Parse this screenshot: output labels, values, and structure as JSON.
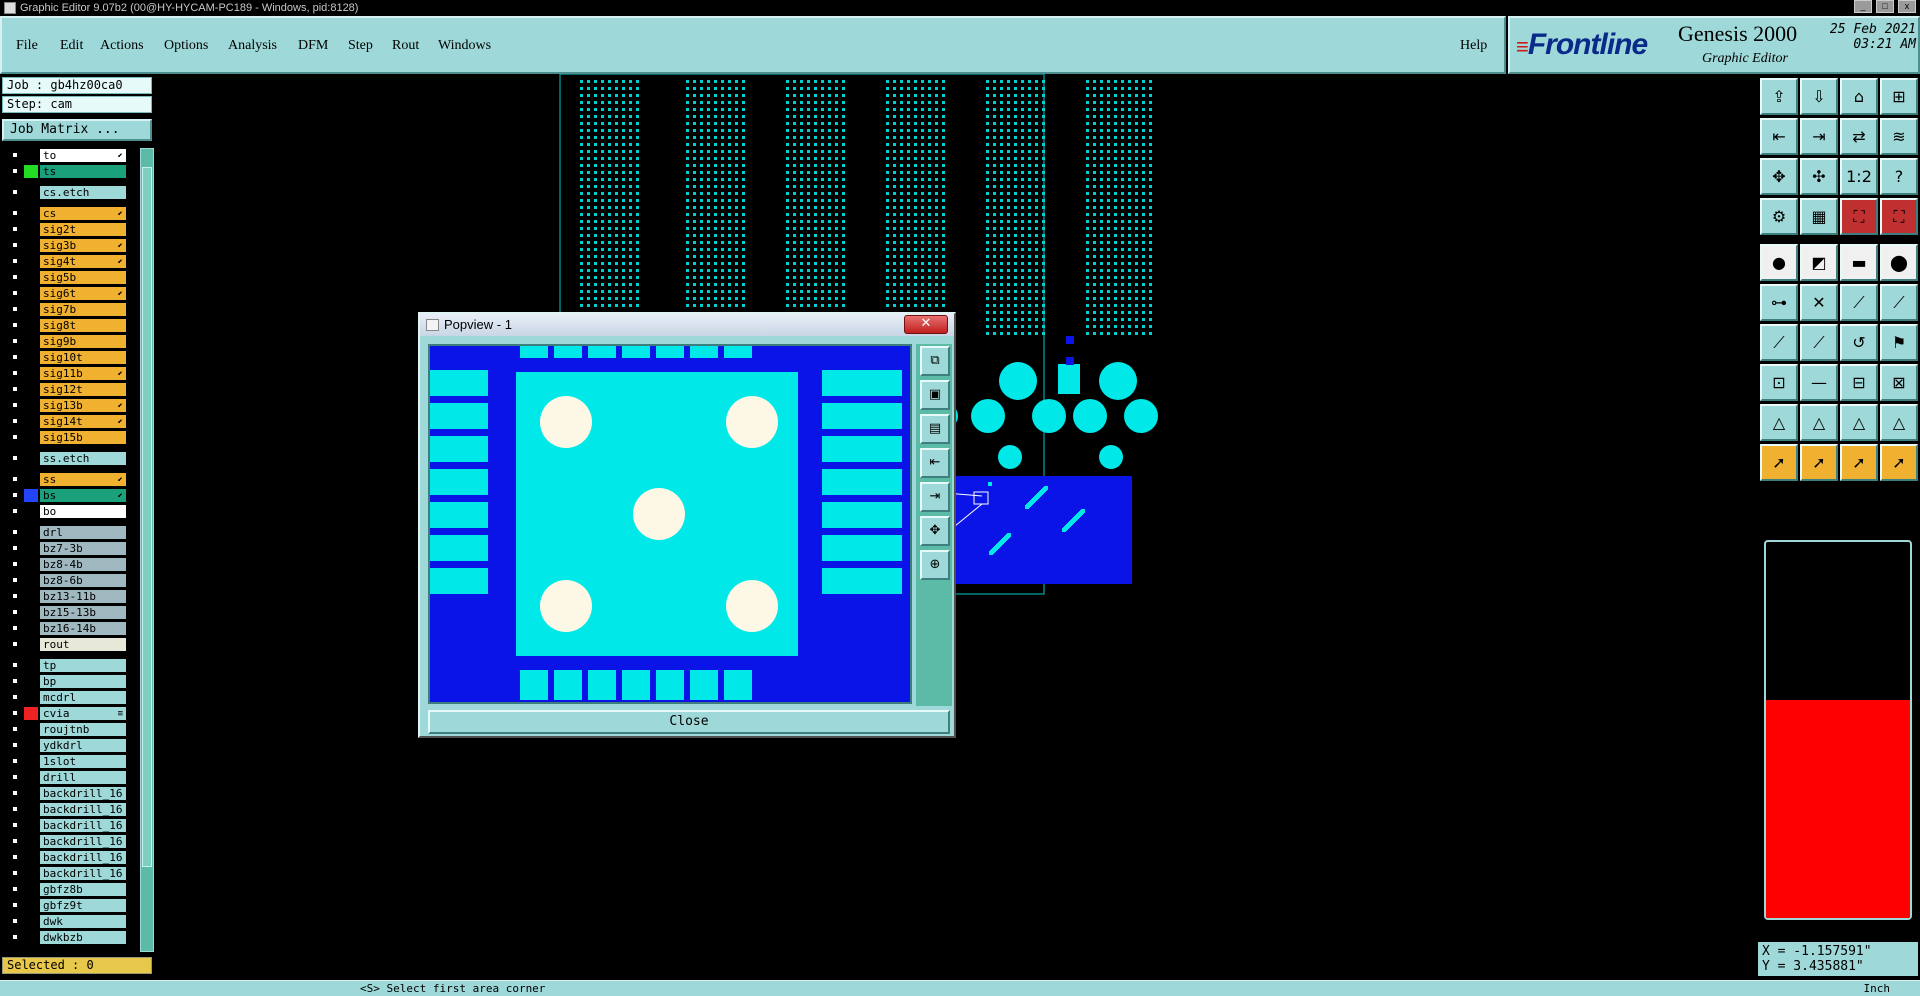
{
  "window": {
    "title": "Graphic Editor 9.07b2 (00@HY-HYCAM-PC189 - Windows, pid:8128)"
  },
  "menu": {
    "file": "File",
    "edit": "Edit",
    "actions": "Actions",
    "options": "Options",
    "analysis": "Analysis",
    "dfm": "DFM",
    "step": "Step",
    "rout": "Rout",
    "windows": "Windows",
    "help": "Help"
  },
  "brand": {
    "logo": "Frontline",
    "product": "Genesis 2000",
    "subtitle": "Graphic Editor",
    "date": "25 Feb 2021",
    "time": "03:21 AM"
  },
  "job": {
    "job_label": "Job : gb4hz00ca0",
    "step_label": "Step: cam",
    "matrix_button": "Job Matrix ..."
  },
  "layers": [
    {
      "name": "to",
      "color": "#ffffff",
      "swatch": "#000000",
      "mark": "⬋"
    },
    {
      "name": "ts",
      "color": "#1aa07a",
      "swatch": "#22dd22",
      "mark": ""
    },
    {
      "name": "cs.etch",
      "color": "#9ed8d8",
      "swatch": "#000000",
      "mark": ""
    },
    {
      "name": "cs",
      "color": "#f0b030",
      "swatch": "#000000",
      "mark": "⬋"
    },
    {
      "name": "sig2t",
      "color": "#f0b030",
      "swatch": "#000000",
      "mark": ""
    },
    {
      "name": "sig3b",
      "color": "#f0b030",
      "swatch": "#000000",
      "mark": "⬋"
    },
    {
      "name": "sig4t",
      "color": "#f0b030",
      "swatch": "#000000",
      "mark": "⬋"
    },
    {
      "name": "sig5b",
      "color": "#f0b030",
      "swatch": "#000000",
      "mark": ""
    },
    {
      "name": "sig6t",
      "color": "#f0b030",
      "swatch": "#000000",
      "mark": "⬋"
    },
    {
      "name": "sig7b",
      "color": "#f0b030",
      "swatch": "#000000",
      "mark": ""
    },
    {
      "name": "sig8t",
      "color": "#f0b030",
      "swatch": "#000000",
      "mark": ""
    },
    {
      "name": "sig9b",
      "color": "#f0b030",
      "swatch": "#000000",
      "mark": ""
    },
    {
      "name": "sig10t",
      "color": "#f0b030",
      "swatch": "#000000",
      "mark": ""
    },
    {
      "name": "sig11b",
      "color": "#f0b030",
      "swatch": "#000000",
      "mark": "⬋"
    },
    {
      "name": "sig12t",
      "color": "#f0b030",
      "swatch": "#000000",
      "mark": ""
    },
    {
      "name": "sig13b",
      "color": "#f0b030",
      "swatch": "#000000",
      "mark": "⬋"
    },
    {
      "name": "sig14t",
      "color": "#f0b030",
      "swatch": "#000000",
      "mark": "⬋"
    },
    {
      "name": "sig15b",
      "color": "#f0b030",
      "swatch": "#000000",
      "mark": ""
    },
    {
      "name": "ss.etch",
      "color": "#9ed8d8",
      "swatch": "#000000",
      "mark": ""
    },
    {
      "name": "ss",
      "color": "#f0b030",
      "swatch": "#000000",
      "mark": "⬋"
    },
    {
      "name": "bs",
      "color": "#1aa07a",
      "swatch": "#2244ff",
      "mark": "⬋"
    },
    {
      "name": "bo",
      "color": "#ffffff",
      "swatch": "#000000",
      "mark": ""
    },
    {
      "name": "drl",
      "color": "#a0b8c0",
      "swatch": "#000000",
      "mark": ""
    },
    {
      "name": "bz7-3b",
      "color": "#a0b8c0",
      "swatch": "#000000",
      "mark": ""
    },
    {
      "name": "bz8-4b",
      "color": "#a0b8c0",
      "swatch": "#000000",
      "mark": ""
    },
    {
      "name": "bz8-6b",
      "color": "#a0b8c0",
      "swatch": "#000000",
      "mark": ""
    },
    {
      "name": "bz13-11b",
      "color": "#a0b8c0",
      "swatch": "#000000",
      "mark": ""
    },
    {
      "name": "bz15-13b",
      "color": "#a0b8c0",
      "swatch": "#000000",
      "mark": ""
    },
    {
      "name": "bz16-14b",
      "color": "#a0b8c0",
      "swatch": "#000000",
      "mark": ""
    },
    {
      "name": "rout",
      "color": "#e8e8d8",
      "swatch": "#000000",
      "mark": ""
    },
    {
      "name": "tp",
      "color": "#9ed8d8",
      "swatch": "#000000",
      "mark": ""
    },
    {
      "name": "bp",
      "color": "#9ed8d8",
      "swatch": "#000000",
      "mark": ""
    },
    {
      "name": "mcdrl",
      "color": "#9ed8d8",
      "swatch": "#000000",
      "mark": ""
    },
    {
      "name": "cvia",
      "color": "#9ed8d8",
      "swatch": "#ee2222",
      "mark": "≡"
    },
    {
      "name": "roujtnb",
      "color": "#9ed8d8",
      "swatch": "#000000",
      "mark": ""
    },
    {
      "name": "ydkdrl",
      "color": "#9ed8d8",
      "swatch": "#000000",
      "mark": ""
    },
    {
      "name": "1slot",
      "color": "#9ed8d8",
      "swatch": "#000000",
      "mark": ""
    },
    {
      "name": "drill",
      "color": "#9ed8d8",
      "swatch": "#000000",
      "mark": ""
    },
    {
      "name": "backdrill_16",
      "color": "#9ed8d8",
      "swatch": "#000000",
      "mark": ""
    },
    {
      "name": "backdrill_16",
      "color": "#9ed8d8",
      "swatch": "#000000",
      "mark": ""
    },
    {
      "name": "backdrill_16",
      "color": "#9ed8d8",
      "swatch": "#000000",
      "mark": ""
    },
    {
      "name": "backdrill_16",
      "color": "#9ed8d8",
      "swatch": "#000000",
      "mark": ""
    },
    {
      "name": "backdrill_16",
      "color": "#9ed8d8",
      "swatch": "#000000",
      "mark": ""
    },
    {
      "name": "backdrill_16",
      "color": "#9ed8d8",
      "swatch": "#000000",
      "mark": ""
    },
    {
      "name": "gbfz8b",
      "color": "#9ed8d8",
      "swatch": "#000000",
      "mark": ""
    },
    {
      "name": "gbfz9t",
      "color": "#9ed8d8",
      "swatch": "#000000",
      "mark": ""
    },
    {
      "name": "dwk",
      "color": "#9ed8d8",
      "swatch": "#000000",
      "mark": ""
    },
    {
      "name": "dwkbzb",
      "color": "#9ed8d8",
      "swatch": "#000000",
      "mark": ""
    }
  ],
  "selected": "Selected : 0",
  "coords": {
    "x": "X = -1.157591\"",
    "y": "Y = 3.435881\""
  },
  "popview": {
    "title": "Popview - 1",
    "close_x": "✕",
    "close_button": "Close"
  },
  "status": {
    "text": "<S>  Select first area corner",
    "unit": "Inch"
  },
  "colors": {
    "board_blue": "#0a14e6",
    "feature_cyan": "#00e8e8",
    "pad_cream": "#fdf8e6",
    "panel_teal": "#9ed8d8",
    "tool_orange": "#f0b030"
  }
}
